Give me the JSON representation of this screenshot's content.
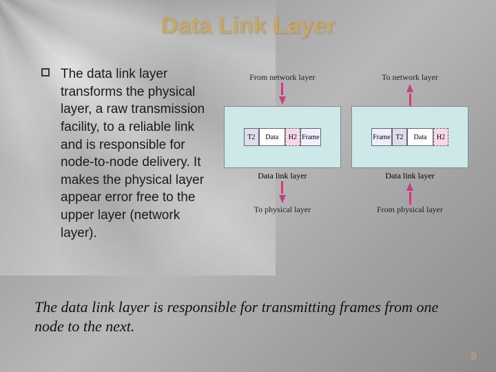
{
  "title": "Data Link Layer",
  "body_text": "The data link layer transforms  the physical layer, a raw transmission facility, to a reliable link and is responsible for node-to-node delivery. It makes the physical layer appear error free to the upper layer (network layer).",
  "summary": "The data link layer is responsible for transmitting frames from one node to the next.",
  "page_number": "9",
  "diagram": {
    "top_left": "From network layer",
    "top_right": "To network layer",
    "left_layer": "Data link layer",
    "right_layer": "Data link layer",
    "bottom_left": "To physical layer",
    "bottom_right": "From physical layer",
    "segments": {
      "t2": "T2",
      "data": "Data",
      "h2": "H2",
      "frame": "Frame"
    }
  }
}
